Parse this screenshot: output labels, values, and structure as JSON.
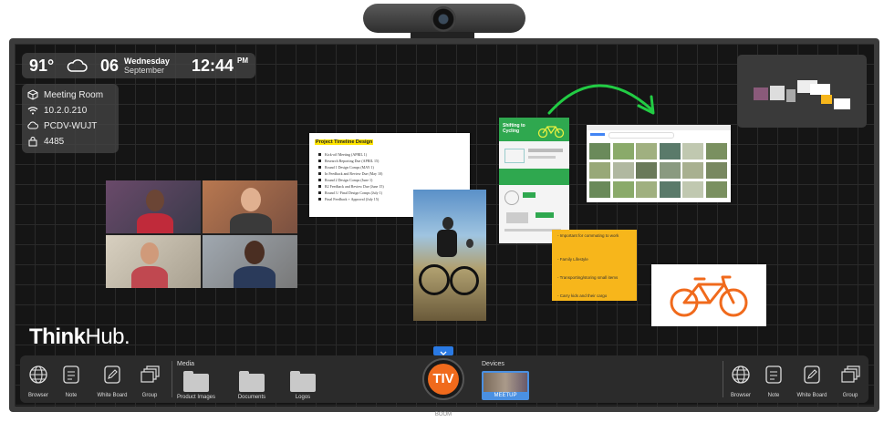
{
  "status": {
    "temperature": "91°",
    "day": "06",
    "weekday": "Wednesday",
    "month": "September",
    "time": "12:44",
    "ampm": "PM"
  },
  "room": {
    "name": "Meeting Room",
    "ip": "10.2.0.210",
    "host": "PCDV-WUJT",
    "code": "4485"
  },
  "doc": {
    "title": "Project Timeline Design",
    "lines": [
      "Kick-off Meeting (APRIL 1)",
      "Research Reporting Due (APRIL 15)",
      "Round 1 Design Comps (MAY 1)",
      "In Feedback and Review Due (May 10)",
      "Round 2 Design Comps (June 1)",
      "R2 Feedback and Review Due (June 15)",
      "Round 3 / Final Design Comps (July 1)",
      "Final Feedback + Approval (July 15)"
    ]
  },
  "sticky": {
    "items": [
      "- Important for commuting to work",
      "- Family Lifestyle",
      "- Transporting/storing small items",
      "- Carry kids and their cargo"
    ]
  },
  "brochure": {
    "title": "Shifting to Cycling"
  },
  "brand": {
    "think": "Think",
    "hub": "Hub."
  },
  "dock": {
    "left_tools": [
      "Browser",
      "Note",
      "White Board",
      "Group"
    ],
    "media_label": "Media",
    "folders": [
      "Product Images",
      "Documents",
      "Logos"
    ],
    "center_logo": "TIV",
    "devices_label": "Devices",
    "device_name": "MEETUP",
    "right_tools": [
      "Browser",
      "Note",
      "White Board",
      "Group"
    ]
  },
  "chin": "BOOM",
  "colors": {
    "accent_orange": "#f06a1c",
    "sticky": "#f7b61b",
    "brochure_green": "#2fa84f",
    "arrow_green": "#22cc44"
  },
  "icons": {
    "weather": "partly-cloudy-icon",
    "room": "cube-icon",
    "wifi": "wifi-icon",
    "cloud": "cloud-icon",
    "lock": "lock-icon"
  }
}
